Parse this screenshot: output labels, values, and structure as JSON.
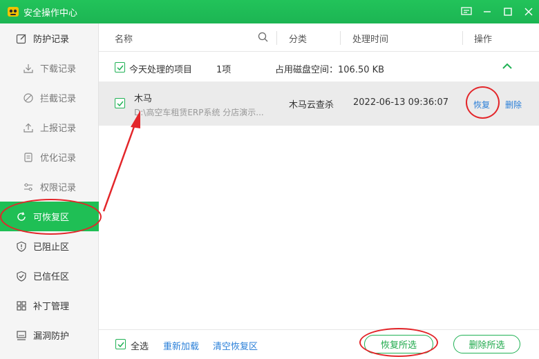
{
  "window": {
    "title": "安全操作中心"
  },
  "sidebar": {
    "items": [
      {
        "label": "防护记录",
        "icon": "edit-icon"
      },
      {
        "label": "下载记录",
        "icon": "download-icon"
      },
      {
        "label": "拦截记录",
        "icon": "block-icon"
      },
      {
        "label": "上报记录",
        "icon": "upload-icon"
      },
      {
        "label": "优化记录",
        "icon": "document-icon"
      },
      {
        "label": "权限记录",
        "icon": "sliders-icon"
      },
      {
        "label": "可恢复区",
        "icon": "restore-icon"
      },
      {
        "label": "已阻止区",
        "icon": "shield-alert-icon"
      },
      {
        "label": "已信任区",
        "icon": "shield-check-icon"
      },
      {
        "label": "补丁管理",
        "icon": "grid-icon"
      },
      {
        "label": "漏洞防护",
        "icon": "monitor-icon"
      }
    ]
  },
  "table": {
    "headers": {
      "name": "名称",
      "category": "分类",
      "time": "处理时间",
      "action": "操作"
    },
    "group": {
      "label": "今天处理的项目",
      "count": "1项",
      "disk": "占用磁盘空间：106.50 KB"
    },
    "rows": [
      {
        "name": "木马",
        "path": "D:\\高空车租赁ERP系统 分店演示...",
        "category": "木马云查杀",
        "time": "2022-06-13 09:36:07",
        "restore": "恢复",
        "delete": "删除"
      }
    ]
  },
  "footer": {
    "select_all": "全选",
    "reload": "重新加载",
    "clear": "清空恢复区",
    "restore_selected": "恢复所选",
    "delete_selected": "删除所选"
  },
  "colors": {
    "brand": "#1fbf55",
    "link": "#2a7fd8",
    "annotation": "#e3262a"
  }
}
